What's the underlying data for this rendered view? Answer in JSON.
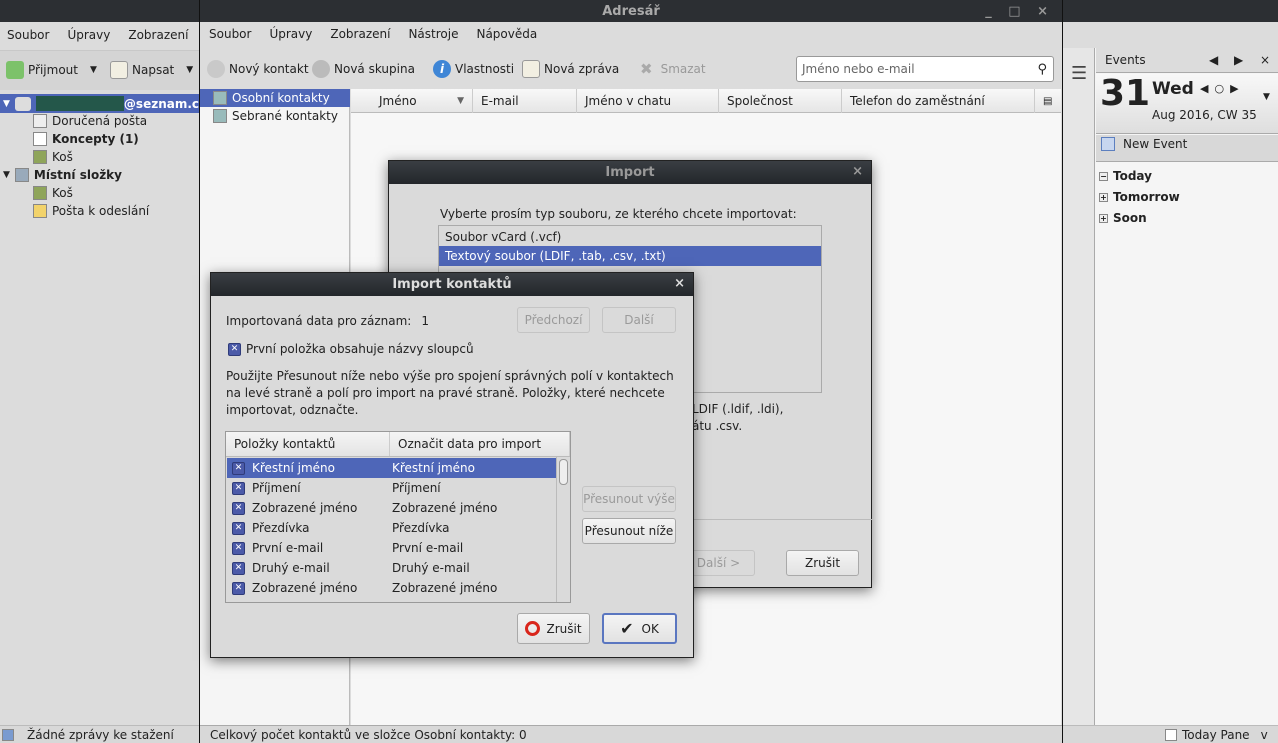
{
  "main": {
    "menu": [
      "Soubor",
      "Úpravy",
      "Zobrazení"
    ],
    "toolbar": {
      "get": "Přijmout",
      "write": "Napsat"
    },
    "account": "@seznam.cz",
    "folders": [
      "Doručená pošta",
      "Koncepty (1)",
      "Koš"
    ],
    "local": "Místní složky",
    "local_folders": [
      "Koš",
      "Pošta k odeslání"
    ],
    "status": "Žádné zprávy ke stažení",
    "today_pane": "Today Pane"
  },
  "addressbook": {
    "title": "Adresář",
    "menu": [
      "Soubor",
      "Úpravy",
      "Zobrazení",
      "Nástroje",
      "Nápověda"
    ],
    "toolbar": {
      "new_contact": "Nový kontakt",
      "new_group": "Nová skupina",
      "properties": "Vlastnosti",
      "new_message": "Nová zpráva",
      "delete": "Smazat"
    },
    "search_placeholder": "Jméno nebo e-mail",
    "books": [
      "Osobní kontakty",
      "Sebrané kontakty"
    ],
    "columns": [
      "Jméno",
      "E-mail",
      "Jméno v chatu",
      "Společnost",
      "Telefon do zaměstnání"
    ],
    "status": "Celkový počet kontaktů ve složce Osobní kontakty: 0"
  },
  "import": {
    "title": "Import",
    "prompt": "Vyberte prosím typ souboru, ze kterého chcete importovat:",
    "options": [
      "Soubor vCard (.vcf)",
      "Textový soubor (LDIF, .tab, .csv, .txt)"
    ],
    "desc1": "LDIF (.ldif, .ldi),",
    "desc2": "átu .csv.",
    "next": "Další >",
    "cancel": "Zrušit"
  },
  "import_contacts": {
    "title": "Import kontaktů",
    "record_label": "Importovaná data pro záznam:",
    "record_value": "1",
    "prev": "Předchozí",
    "next": "Další",
    "first_row_label": "První položka obsahuje názvy sloupců",
    "instructions": "Použijte Přesunout níže nebo výše pro spojení správných polí v kontaktech na levé straně a polí pro import na pravé straně. Položky, které nechcete importovat, odznačte.",
    "col1": "Položky kontaktů",
    "col2": "Označit data pro import",
    "rows": [
      [
        "Křestní jméno",
        "Křestní jméno"
      ],
      [
        "Příjmení",
        "Příjmení"
      ],
      [
        "Zobrazené jméno",
        "Zobrazené jméno"
      ],
      [
        "Přezdívka",
        "Přezdívka"
      ],
      [
        "První e-mail",
        "První e-mail"
      ],
      [
        "Druhý e-mail",
        "Druhý e-mail"
      ],
      [
        "Zobrazené jméno",
        "Zobrazené jméno"
      ]
    ],
    "move_up": "Přesunout výše",
    "move_down": "Přesunout níže",
    "cancel": "Zrušit",
    "ok": "OK"
  },
  "events": {
    "title": "Events",
    "day": "31",
    "weekday": "Wed",
    "month": "Aug 2016, CW 35",
    "new_event": "New Event",
    "groups": [
      "Today",
      "Tomorrow",
      "Soon"
    ]
  },
  "colors": {
    "selection": "#4e66b8",
    "titlebar": "#2c2f33"
  }
}
